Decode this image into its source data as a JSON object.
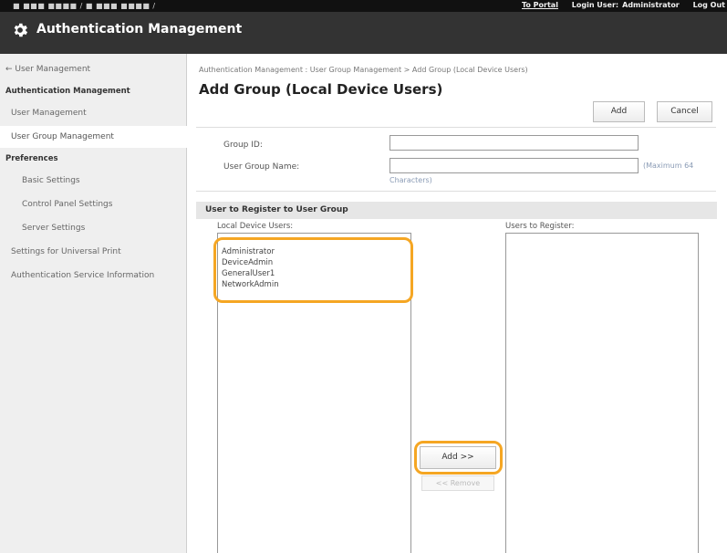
{
  "topbar": {
    "device": "■ ■■■ ■■■■ / ■ ■■■ ■■■■ /",
    "to_portal": "To Portal",
    "login_label": "Login User:",
    "login_user": "Administrator",
    "logout": "Log Out"
  },
  "app": {
    "title": "Authentication Management",
    "icon": "gear-icon"
  },
  "sidebar": {
    "items": [
      {
        "label": "← User Management"
      },
      {
        "label": "Authentication Management"
      },
      {
        "label": "User Management"
      },
      {
        "label": "User Group Management"
      },
      {
        "label": "Preferences"
      },
      {
        "label": "Basic Settings"
      },
      {
        "label": "Control Panel Settings"
      },
      {
        "label": "Server Settings"
      },
      {
        "label": "Settings for Universal Print"
      },
      {
        "label": "Authentication Service Information"
      }
    ]
  },
  "main": {
    "breadcrumb": "Authentication Management : User Group Management > Add Group (Local Device Users)",
    "title": "Add Group (Local Device Users)",
    "add_label": "Add",
    "cancel_label": "Cancel",
    "group_id_label": "Group ID:",
    "group_id_value": "",
    "group_name_label": "User Group Name:",
    "group_name_value": "",
    "max_hint": "(Maximum 64",
    "max_hint2": "Characters)",
    "section_title": "User to Register to User Group",
    "local_users_label": "Local Device Users:",
    "local_users": [
      "Administrator",
      "DeviceAdmin",
      "GeneralUser1",
      "NetworkAdmin"
    ],
    "users_to_register_label": "Users to Register:",
    "add_arrow_label": "Add >>",
    "remove_label": "<< Remove"
  },
  "colors": {
    "highlight": "#f5a623",
    "titlebar": "#333333",
    "topbar": "#111111"
  }
}
